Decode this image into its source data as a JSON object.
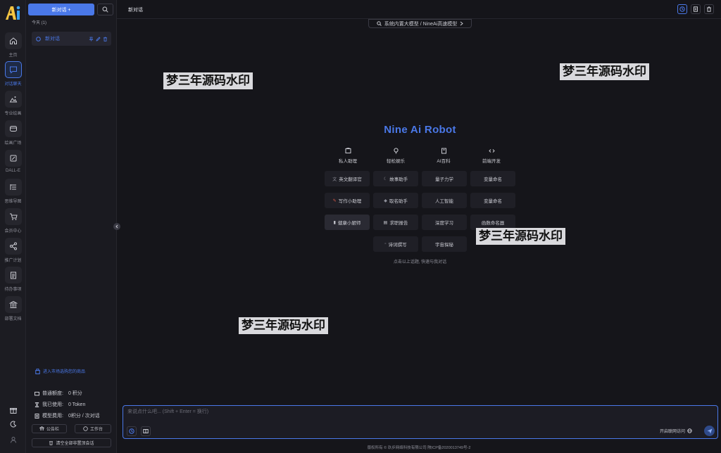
{
  "rail": {
    "items": [
      {
        "label": "主页",
        "icon": "home-icon"
      },
      {
        "label": "对话聊天",
        "icon": "chat-icon",
        "active": true
      },
      {
        "label": "专业绘画",
        "icon": "image-icon"
      },
      {
        "label": "绘画广场",
        "icon": "gallery-icon"
      },
      {
        "label": "DALL-E",
        "icon": "palette-icon"
      },
      {
        "label": "思维导图",
        "icon": "mindmap-icon"
      },
      {
        "label": "会员中心",
        "icon": "cart-icon"
      },
      {
        "label": "推广计划",
        "icon": "share-icon"
      },
      {
        "label": "待办事项",
        "icon": "clipboard-icon"
      },
      {
        "label": "部署文档",
        "icon": "bank-icon"
      }
    ]
  },
  "panel": {
    "new_chat_label": "新对话 +",
    "today_label": "今天 (1)",
    "chat_item_title": "新对话",
    "market_link": "进入市场选购您的商品",
    "balance_rows": [
      {
        "label": "普通额度:",
        "value": "0 积分"
      },
      {
        "label": "我已使用:",
        "value": "0 Token"
      },
      {
        "label": "模型费用:",
        "value": "0积分 / 次对话"
      }
    ],
    "announcement_label": "公告栏",
    "workbench_label": "工作台",
    "clear_label": "清空全部非置顶会话"
  },
  "header": {
    "title": "新对话",
    "model_selector": "系统内置大模型 / NineAi高速模型"
  },
  "hero": {
    "brand": "Nine Ai Robot",
    "categories": [
      {
        "label": "私人助理",
        "icon": "box-icon"
      },
      {
        "label": "轻松娱乐",
        "icon": "bulb-icon"
      },
      {
        "label": "AI百科",
        "icon": "book-icon"
      },
      {
        "label": "前端开发",
        "icon": "code-icon"
      }
    ],
    "prompts": [
      {
        "label": "英文翻译官",
        "icon": "translate-icon"
      },
      {
        "label": "故事助手",
        "icon": "moon-icon"
      },
      {
        "label": "量子力学",
        "icon": ""
      },
      {
        "label": "变量命名",
        "icon": ""
      },
      {
        "label": "写作小助理",
        "icon": "pen-icon"
      },
      {
        "label": "取名助手",
        "icon": "tag-icon"
      },
      {
        "label": "人工智能",
        "icon": ""
      },
      {
        "label": "变量命名",
        "icon": ""
      },
      {
        "label": "健康小厨师",
        "icon": "chef-icon"
      },
      {
        "label": "求职报告",
        "icon": "doc-icon"
      },
      {
        "label": "深度学习",
        "icon": ""
      },
      {
        "label": "函数命名器",
        "icon": ""
      },
      {
        "label": "诗词撰写",
        "icon": "poem-icon"
      },
      {
        "label": "宇宙探秘",
        "icon": ""
      }
    ],
    "hint": "点击以上话题, 快速与我对话"
  },
  "watermarks": [
    "梦三年源码水印",
    "梦三年源码水印",
    "梦三年源码水印",
    "梦三年源码水印"
  ],
  "input": {
    "placeholder": "来说点什么吧... (Shift + Enter = 换行)",
    "web_toggle_label": "开启联网访问"
  },
  "footer": {
    "text": "版权所有 © 玖步网络科技有限公司  陕ICP备2020013749号-2"
  },
  "colors": {
    "accent": "#4a78e8",
    "background": "#15151a",
    "panel": "#1a1a20"
  }
}
